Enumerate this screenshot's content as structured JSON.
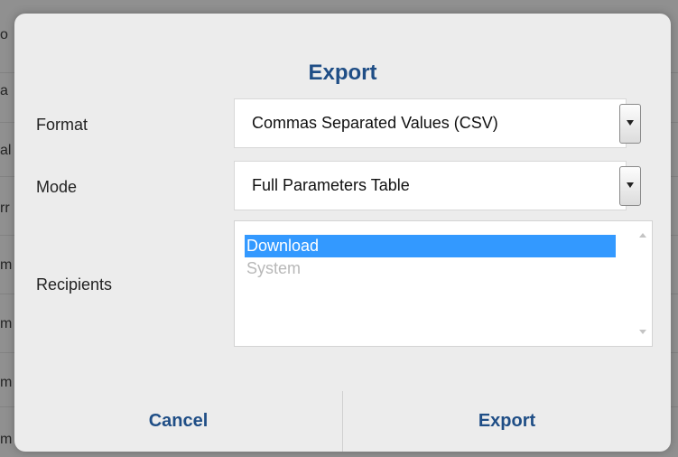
{
  "dialog": {
    "title": "Export",
    "format": {
      "label": "Format",
      "value": "Commas Separated Values (CSV)"
    },
    "mode": {
      "label": "Mode",
      "value": "Full Parameters Table"
    },
    "recipients": {
      "label": "Recipients",
      "items": [
        {
          "label": "Download",
          "selected": true
        },
        {
          "label": "System",
          "disabled": true
        }
      ]
    },
    "buttons": {
      "cancel": "Cancel",
      "export": "Export"
    }
  },
  "background": {
    "fragments": [
      "o",
      "a",
      "al",
      "rr",
      "m",
      "m",
      "m",
      "m"
    ]
  },
  "colors": {
    "accent": "#1f4e86",
    "selection": "#3399ff",
    "dialog_bg": "#ececec"
  }
}
